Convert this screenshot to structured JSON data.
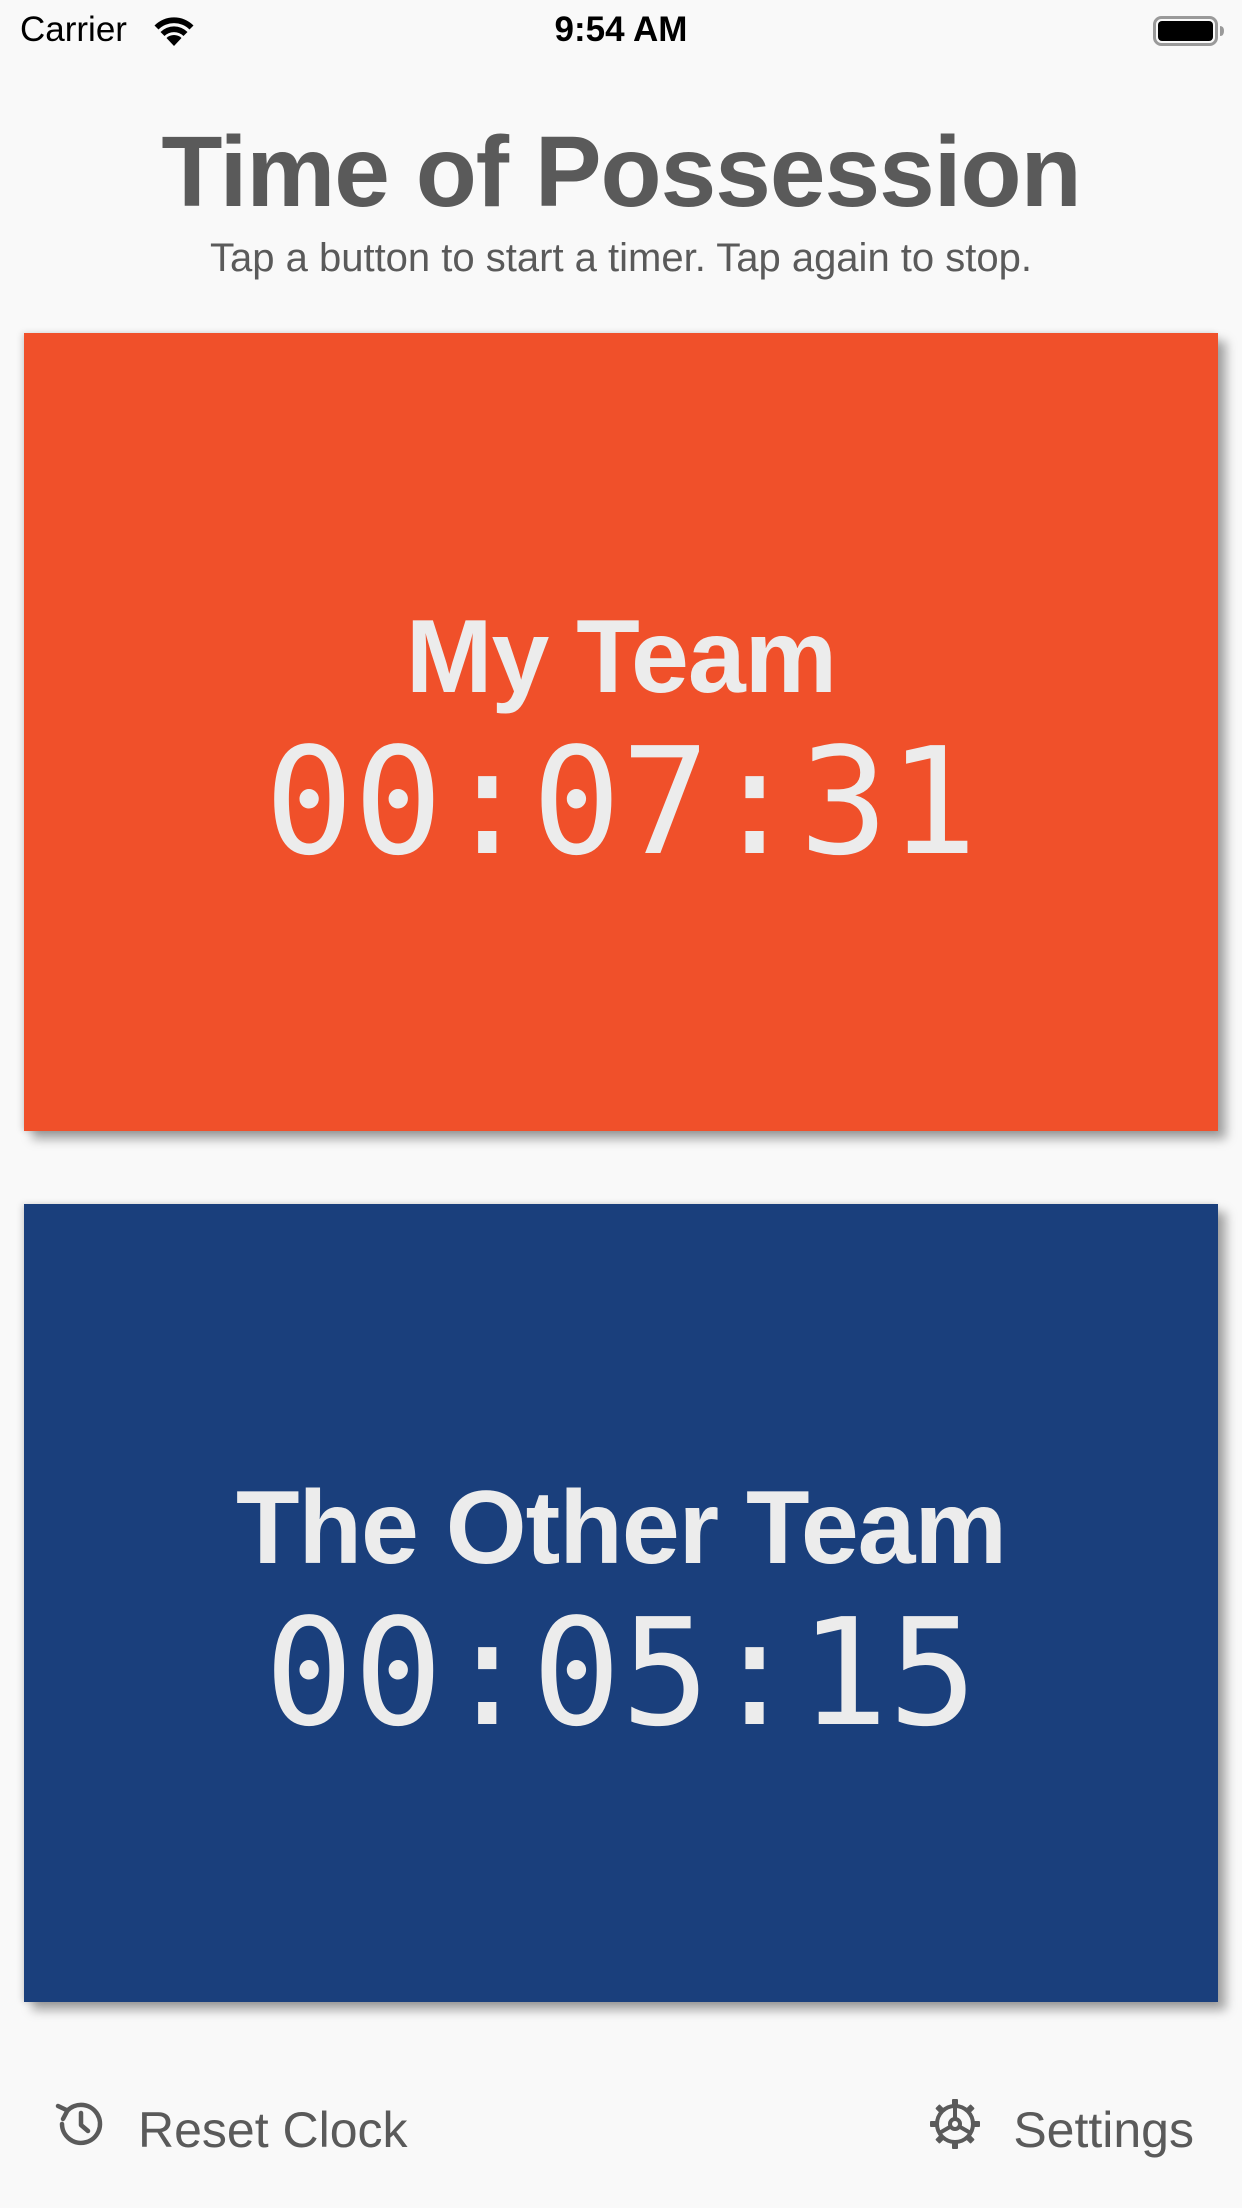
{
  "status_bar": {
    "carrier": "Carrier",
    "time": "9:54 AM",
    "wifi_icon": "wifi-icon",
    "battery_icon": "battery-icon"
  },
  "header": {
    "title": "Time of Possession",
    "subtitle": "Tap a button to start a timer. Tap again to stop."
  },
  "teams": [
    {
      "name": "My Team",
      "time": "00:07:31",
      "color": "#f0502a"
    },
    {
      "name": "The Other Team",
      "time": "00:05:15",
      "color": "#1a3f7c"
    }
  ],
  "bottom_bar": {
    "reset_label": "Reset Clock",
    "reset_icon": "history-icon",
    "settings_label": "Settings",
    "settings_icon": "gear-icon"
  },
  "colors": {
    "background": "#f9f9f9",
    "text_gray": "#5a5a5a",
    "team_text": "#ececec"
  }
}
